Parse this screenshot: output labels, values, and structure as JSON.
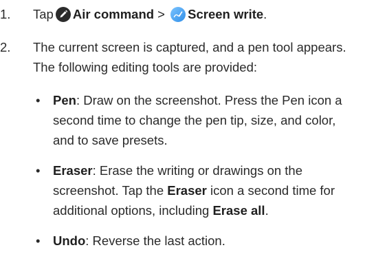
{
  "steps": [
    {
      "number": "1.",
      "text_before": "Tap",
      "icon1": "air-command-pen-icon",
      "air_command": "Air command",
      "separator": " > ",
      "icon2": "screen-write-icon",
      "screen_write": "Screen write",
      "end": "."
    },
    {
      "number": "2.",
      "text": "The current screen is captured, and a pen tool appears. The following editing tools are provided:"
    }
  ],
  "tools": [
    {
      "bullet": "•",
      "name": "Pen",
      "description": ": Draw on the screenshot. Press the Pen icon a second time to change the pen tip, size, and color, and to save presets."
    },
    {
      "bullet": "•",
      "name": "Eraser",
      "desc_a": ": Erase the writing or drawings on the screenshot. Tap the ",
      "name2": "Eraser",
      "desc_b": " icon a second time for additional options, including ",
      "name3": "Erase all",
      "desc_c": "."
    },
    {
      "bullet": "•",
      "name": "Undo",
      "description": ": Reverse the last action."
    }
  ],
  "colors": {
    "air_command_icon": "#2b2b2b",
    "screen_write_icon": "#4aa3f0"
  }
}
